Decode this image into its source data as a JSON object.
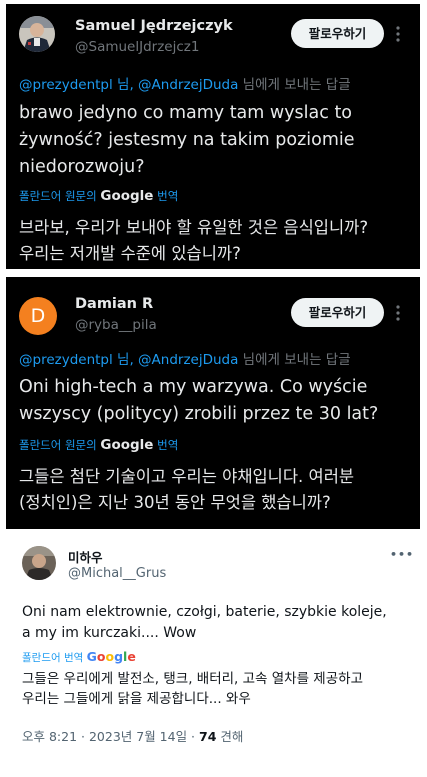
{
  "tweets": [
    {
      "name": "Samuel Jędrzejczyk",
      "handle": "@SamuelJdrzejcz1",
      "follow_label": "팔로우하기",
      "more_label": "⋮",
      "reply_mentions": "@prezydentpl 님, @AndrzejDuda",
      "reply_suffix": " 님에게 보내는 답글",
      "text_lines": [
        "brawo jedyno co mamy tam wyslac to",
        "żywność?  jestesmy na takim poziomie",
        "niedorozwoju?"
      ],
      "translate_prefix": "폴란드어 원문의 ",
      "translate_google": "Google",
      "translate_suffix": " 번역",
      "translation_lines": [
        "브라보, 우리가 보내야 할 유일한 것은 음식입니까?",
        "우리는 저개발 수준에 있습니까?"
      ]
    },
    {
      "name": "Damian R",
      "handle": "@ryba__pila",
      "avatar_letter": "D",
      "follow_label": "팔로우하기",
      "more_label": "⋮",
      "reply_mentions": "@prezydentpl 님, @AndrzejDuda",
      "reply_suffix": " 님에게 보내는 답글",
      "text_lines": [
        "Oni high-tech a my warzywa. Co wyście",
        "wszyscy (politycy) zrobili przez te 30 lat?"
      ],
      "translate_prefix": "폴란드어 원문의 ",
      "translate_google": "Google",
      "translate_suffix": " 번역",
      "translation_lines": [
        "그들은 첨단 기술이고 우리는 야채입니다. 여러분",
        "(정치인)은 지난 30년 동안 무엇을 했습니까?"
      ]
    },
    {
      "name": "미하우",
      "handle": "@Michal__Grus",
      "more_label": "•••",
      "text_lines": [
        "Oni nam elektrownie, czołgi, baterie, szybkie koleje,",
        "a my im kurczaki.... Wow"
      ],
      "translate_prefix": "폴란드어 번역 ",
      "translate_google": "Google",
      "translation_lines": [
        "그들은 우리에게 발전소, 탱크, 배터리, 고속 열차를 제공하고",
        "우리는 그들에게 닭을 제공합니다... 와우"
      ],
      "meta_time": "오후 8:21 · 2023년 7월 14일 · ",
      "meta_views_count": "74",
      "meta_views_label": " 견해"
    }
  ],
  "colors": {
    "link": "#1d9bf0",
    "avatar_d": "#f4801f",
    "dark_bg": "#000000"
  }
}
